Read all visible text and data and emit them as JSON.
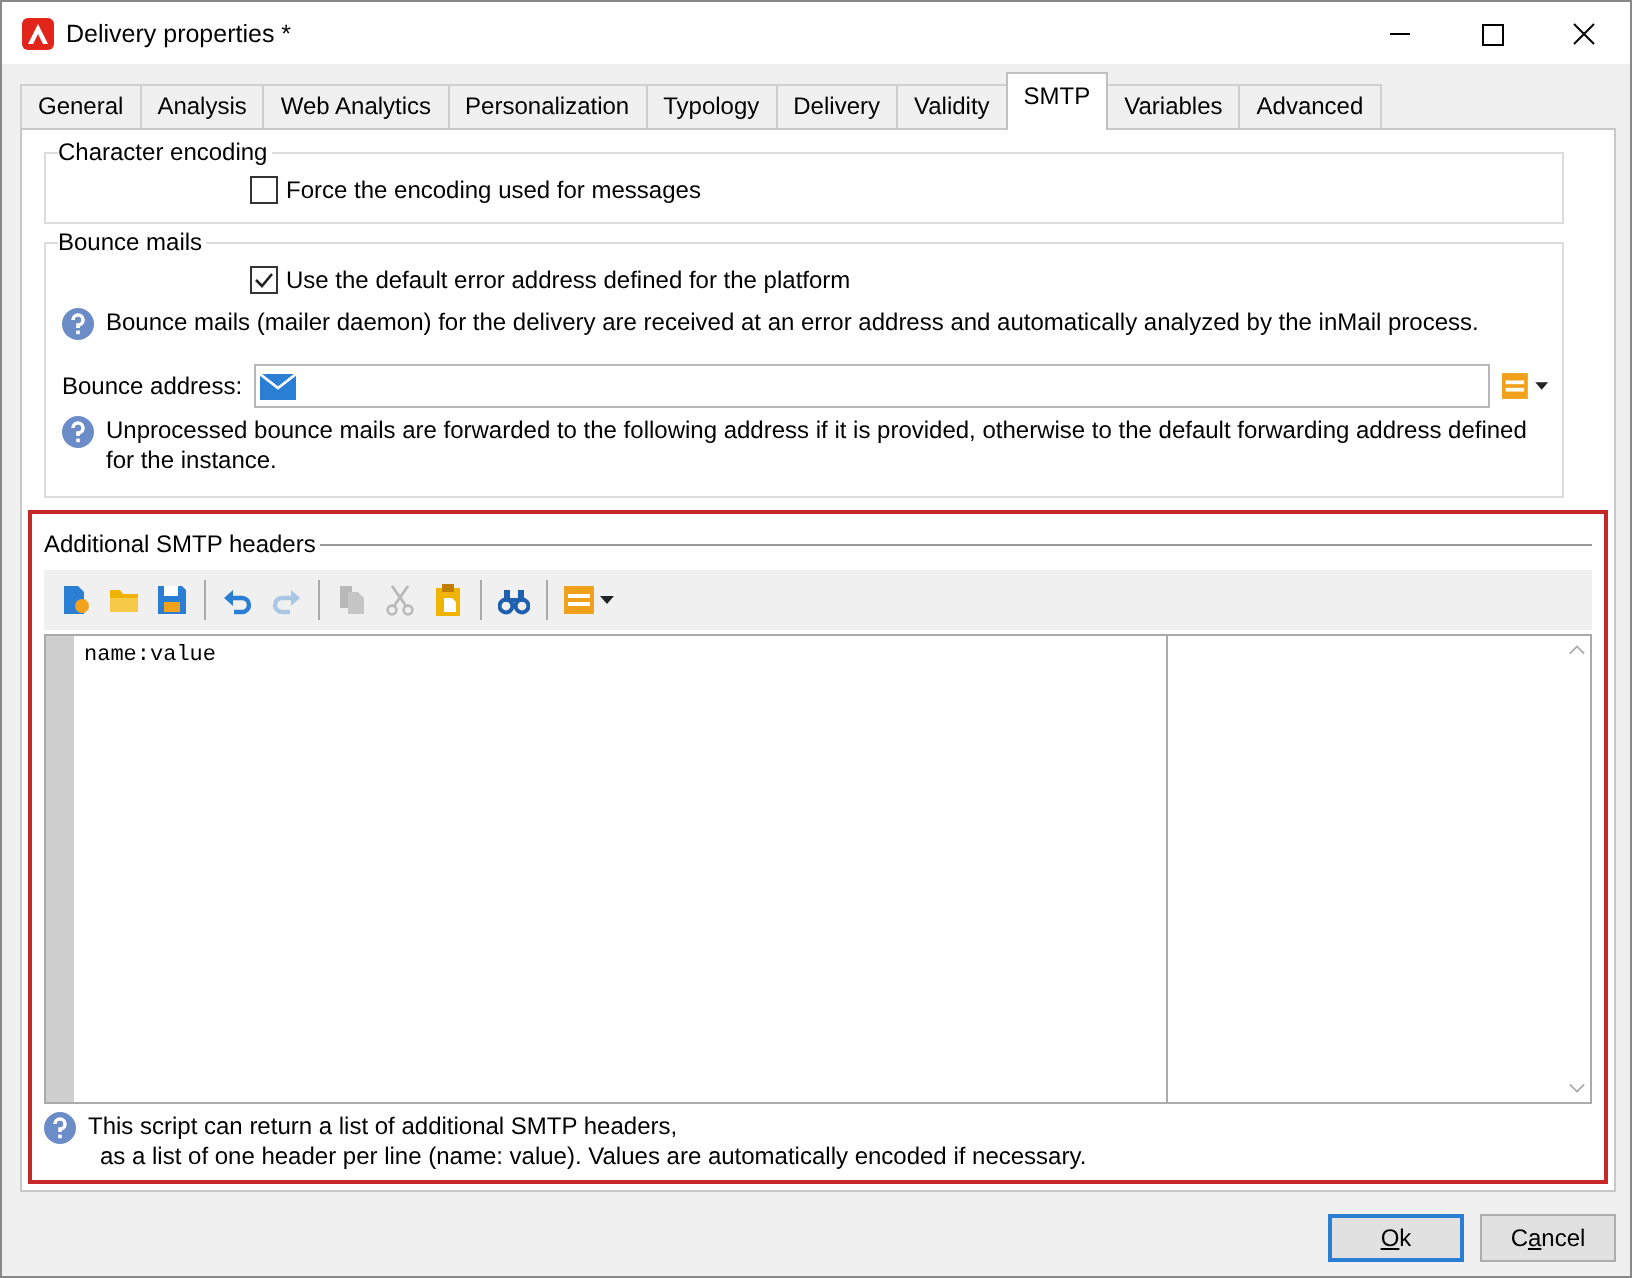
{
  "window": {
    "title": "Delivery properties *"
  },
  "tabs": [
    {
      "label": "General",
      "selected": false
    },
    {
      "label": "Analysis",
      "selected": false
    },
    {
      "label": "Web Analytics",
      "selected": false
    },
    {
      "label": "Personalization",
      "selected": false
    },
    {
      "label": "Typology",
      "selected": false
    },
    {
      "label": "Delivery",
      "selected": false
    },
    {
      "label": "Validity",
      "selected": false
    },
    {
      "label": "SMTP",
      "selected": true
    },
    {
      "label": "Variables",
      "selected": false
    },
    {
      "label": "Advanced",
      "selected": false
    }
  ],
  "character_encoding": {
    "title": "Character encoding",
    "checkbox": {
      "label": "Force the encoding used for messages",
      "checked": false
    }
  },
  "bounce_mails": {
    "title": "Bounce mails",
    "checkbox": {
      "label": "Use the default error address defined for the platform",
      "checked": true
    },
    "info": "Bounce mails (mailer daemon) for the delivery are received at an error address and automatically analyzed by the inMail process.",
    "address_label": "Bounce address:",
    "address_note": "Unprocessed bounce mails are forwarded to the following address if it is provided, otherwise to the default forwarding address defined for the instance."
  },
  "smtp_headers": {
    "title": "Additional SMTP headers",
    "toolbar": [
      {
        "kind": "new",
        "disabled": false
      },
      {
        "kind": "open",
        "disabled": false
      },
      {
        "kind": "save",
        "disabled": false
      },
      {
        "kind": "sep"
      },
      {
        "kind": "undo",
        "disabled": false
      },
      {
        "kind": "redo",
        "disabled": true
      },
      {
        "kind": "sep"
      },
      {
        "kind": "copy",
        "disabled": true
      },
      {
        "kind": "cut",
        "disabled": true
      },
      {
        "kind": "paste",
        "disabled": false
      },
      {
        "kind": "sep"
      },
      {
        "kind": "find",
        "disabled": false
      },
      {
        "kind": "sep"
      },
      {
        "kind": "insert",
        "disabled": false
      }
    ],
    "code": "name:value",
    "note_lines": [
      "This script can return a list of additional SMTP headers,",
      "as a list of one header per line (name: value). Values are automatically encoded if necessary."
    ]
  },
  "buttons": [
    {
      "parts": [
        {
          "text": "O",
          "underlined": true
        },
        {
          "text": "k",
          "underlined": false
        }
      ],
      "default": true
    },
    {
      "parts": [
        {
          "text": "C",
          "underlined": false
        },
        {
          "text": "a",
          "underlined": true
        },
        {
          "text": "ncel",
          "underlined": false
        }
      ],
      "default": false
    }
  ]
}
